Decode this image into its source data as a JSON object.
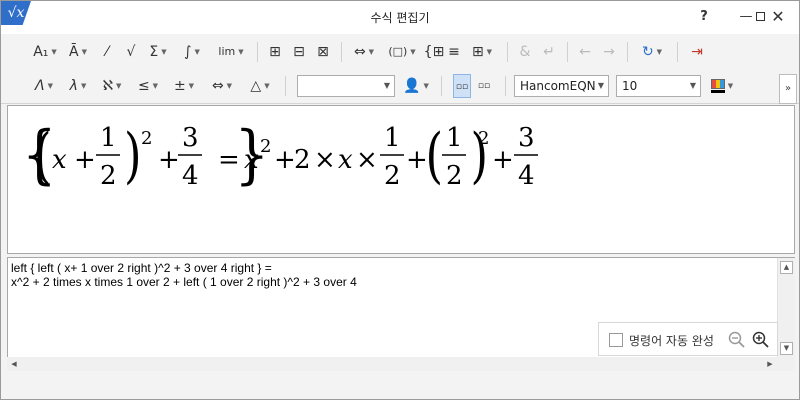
{
  "window": {
    "title": "수식 편집기",
    "app_icon": "√x",
    "help_label": "?",
    "minimize_label": "—",
    "maximize_label": "□",
    "close_label": "✕"
  },
  "toolbar": {
    "row1": [
      {
        "name": "subscript-superscript-button",
        "label": "A₁",
        "caret": true
      },
      {
        "name": "decoration-button",
        "label": "Ā",
        "caret": true
      },
      {
        "name": "fraction-button",
        "label": "⁄",
        "caret": false
      },
      {
        "name": "root-button",
        "label": "√",
        "caret": false
      },
      {
        "name": "sum-button",
        "label": "Σ",
        "caret": true
      },
      {
        "name": "integral-button",
        "label": "∫",
        "caret": true
      },
      {
        "name": "limit-button",
        "label": "lim",
        "caret": true
      },
      {
        "name": "matrix-button-1",
        "label": "⊞",
        "caret": false
      },
      {
        "name": "matrix-button-2",
        "label": "⊟",
        "caret": false
      },
      {
        "name": "matrix-button-3",
        "label": "⊠",
        "caret": false
      },
      {
        "name": "align-button",
        "label": "⇔",
        "caret": true
      },
      {
        "name": "bracket-button",
        "label": "(□)",
        "caret": true
      },
      {
        "name": "cases-button",
        "label": "{⊞",
        "caret": false
      },
      {
        "name": "lines-button",
        "label": "≡",
        "caret": false
      },
      {
        "name": "grid-button",
        "label": "⊞",
        "caret": true
      },
      {
        "name": "ampersand-button",
        "label": "&",
        "caret": false,
        "dim": true
      },
      {
        "name": "newline-button",
        "label": "↵",
        "caret": false,
        "dim": true
      },
      {
        "name": "undo-button",
        "label": "←",
        "caret": false,
        "dim": true
      },
      {
        "name": "redo-button",
        "label": "→",
        "caret": false,
        "dim": true
      },
      {
        "name": "refresh-button",
        "label": "↻",
        "caret": true
      },
      {
        "name": "exit-button",
        "label": "⇥",
        "caret": false
      }
    ],
    "row2": [
      {
        "name": "greek-lower-button",
        "label": "Λ",
        "caret": true
      },
      {
        "name": "lambda-button",
        "label": "λ",
        "caret": true
      },
      {
        "name": "aleph-button",
        "label": "ℵ",
        "caret": true
      },
      {
        "name": "relation-button",
        "label": "≤",
        "caret": true
      },
      {
        "name": "operator-button",
        "label": "±",
        "caret": true
      },
      {
        "name": "arrow-button",
        "label": "⇔",
        "caret": true
      },
      {
        "name": "misc-symbol-button",
        "label": "△",
        "caret": true
      }
    ],
    "style_combo_value": "",
    "font_combo_value": "HancomEQN",
    "size_combo_value": "10",
    "overflow_label": "»"
  },
  "editor": {
    "line1": "left { left ( x+ 1 over 2 right )^2 + 3 over 4 right } =",
    "line2": "x^2 + 2 times x times 1 over 2 + left ( 1 over 2 right )^2 + 3 over 4"
  },
  "autocomplete": {
    "label": "명령어 자동 완성"
  },
  "formula": {
    "x": "x",
    "plus": "+",
    "one": "1",
    "two": "2",
    "three": "3",
    "four": "4",
    "equals": "=",
    "times": "×",
    "exp": "2"
  }
}
